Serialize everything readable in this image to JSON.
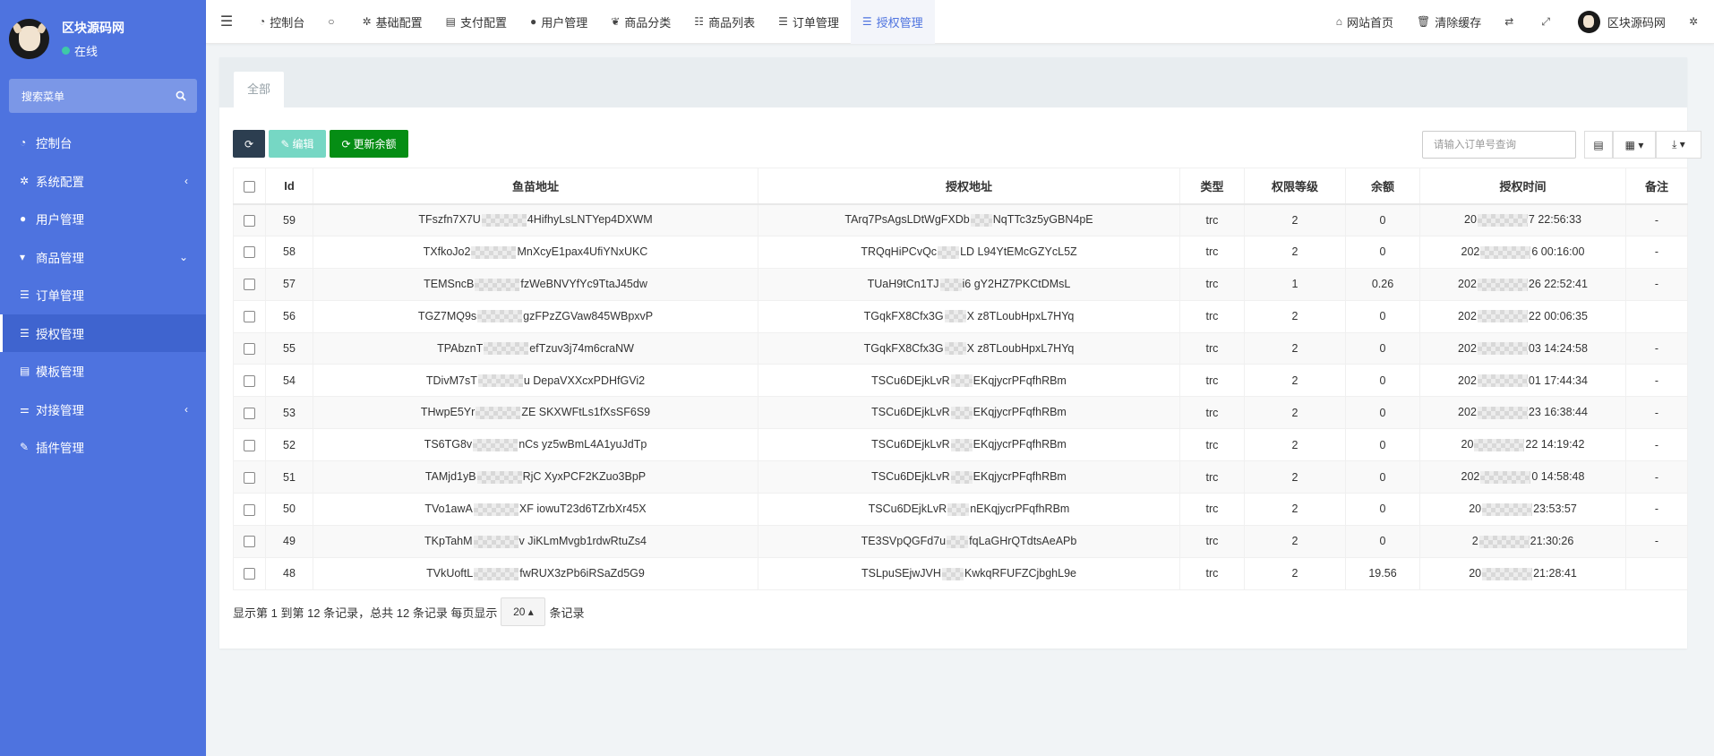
{
  "sidebar": {
    "user_name": "区块源码网",
    "status": "在线",
    "status_color": "#3ec9a7",
    "search_placeholder": "搜索菜单",
    "search_icon": "search-icon",
    "items": [
      {
        "label": "控制台",
        "icon": "dashboard-icon",
        "has_arrow": false
      },
      {
        "label": "系统配置",
        "icon": "gear-icon",
        "has_arrow": true
      },
      {
        "label": "用户管理",
        "icon": "user-icon",
        "has_arrow": false
      },
      {
        "label": "商品管理",
        "icon": "cart-icon",
        "has_arrow": true
      },
      {
        "label": "订单管理",
        "icon": "list-icon",
        "has_arrow": false
      },
      {
        "label": "授权管理",
        "icon": "list-icon",
        "has_arrow": false,
        "active": true
      },
      {
        "label": "模板管理",
        "icon": "template-icon",
        "has_arrow": false
      },
      {
        "label": "对接管理",
        "icon": "sliders-icon",
        "has_arrow": true
      },
      {
        "label": "插件管理",
        "icon": "plugin-icon",
        "has_arrow": false
      }
    ]
  },
  "navbar": {
    "tabs": [
      {
        "label": "控制台",
        "icon": "dashboard-icon"
      },
      {
        "label": "基础配置",
        "icon": "gear-icon"
      },
      {
        "label": "支付配置",
        "icon": "card-icon"
      },
      {
        "label": "用户管理",
        "icon": "user-icon"
      },
      {
        "label": "商品分类",
        "icon": "leaf-icon"
      },
      {
        "label": "商品列表",
        "icon": "list-icon"
      },
      {
        "label": "订单管理",
        "icon": "list-icon"
      },
      {
        "label": "授权管理",
        "icon": "list-icon",
        "active": true
      }
    ],
    "right": {
      "home_label": "网站首页",
      "clear_cache_label": "清除缓存",
      "user_name": "区块源码网"
    }
  },
  "content": {
    "tab_label": "全部",
    "toolbar": {
      "edit_label": "编辑",
      "update_balance_label": "更新余额",
      "search_placeholder": "请输入订单号查询"
    },
    "table": {
      "columns": [
        "Id",
        "鱼苗地址",
        "授权地址",
        "类型",
        "权限等级",
        "余额",
        "授权时间",
        "备注"
      ],
      "rows": [
        {
          "id": "59",
          "fish_a": "TFszfn7X7U",
          "fish_b": "4HifhyLsLNTYep4DXWM",
          "auth_a": "TArq7PsAgsLDtWgFXDb",
          "auth_b": "NqTTc3z5yGBN4pE",
          "type": "trc",
          "level": "2",
          "balance": "0",
          "time_a": "20",
          "time_b": "7 22:56:33",
          "note": "-"
        },
        {
          "id": "58",
          "fish_a": "TXfkoJo2",
          "fish_b": "MnXcyE1pax4UfiYNxUKC",
          "auth_a": "TRQqHiPCvQc",
          "auth_b": "LD   L94YtEMcGZYcL5Z",
          "type": "trc",
          "level": "2",
          "balance": "0",
          "time_a": "202",
          "time_b": "6 00:16:00",
          "note": "-"
        },
        {
          "id": "57",
          "fish_a": "TEMSncB",
          "fish_b": "fzWeBNVYfYc9TtaJ45dw",
          "auth_a": "TUaH9tCn1TJ",
          "auth_b": "i6   gY2HZ7PKCtDMsL",
          "type": "trc",
          "level": "1",
          "balance": "0.26",
          "time_a": "202",
          "time_b": "26 22:52:41",
          "note": "-"
        },
        {
          "id": "56",
          "fish_a": "TGZ7MQ9s",
          "fish_b": "gzFPzZGVaw845WBpxvP",
          "auth_a": "TGqkFX8Cfx3G",
          "auth_b": "X   z8TLoubHpxL7HYq",
          "type": "trc",
          "level": "2",
          "balance": "0",
          "time_a": "202",
          "time_b": "22 00:06:35",
          "note": ""
        },
        {
          "id": "55",
          "fish_a": "TPAbznT",
          "fish_b": "efTzuv3j74m6craNW",
          "auth_a": "TGqkFX8Cfx3G",
          "auth_b": "X   z8TLoubHpxL7HYq",
          "type": "trc",
          "level": "2",
          "balance": "0",
          "time_a": "202",
          "time_b": "03 14:24:58",
          "note": "-"
        },
        {
          "id": "54",
          "fish_a": "TDivM7sT",
          "fish_b": "u   DepaVXXcxPDHfGVi2",
          "auth_a": "TSCu6DEjkLvR",
          "auth_b": "EKqjycrPFqfhRBm",
          "type": "trc",
          "level": "2",
          "balance": "0",
          "time_a": "202",
          "time_b": "01 17:44:34",
          "note": "-"
        },
        {
          "id": "53",
          "fish_a": "THwpE5Yr",
          "fish_b": "ZE   SKXWFtLs1fXsSF6S9",
          "auth_a": "TSCu6DEjkLvR",
          "auth_b": "EKqjycrPFqfhRBm",
          "type": "trc",
          "level": "2",
          "balance": "0",
          "time_a": "202",
          "time_b": "23 16:38:44",
          "note": "-"
        },
        {
          "id": "52",
          "fish_a": "TS6TG8v",
          "fish_b": "nCs   yz5wBmL4A1yuJdTp",
          "auth_a": "TSCu6DEjkLvR",
          "auth_b": "EKqjycrPFqfhRBm",
          "type": "trc",
          "level": "2",
          "balance": "0",
          "time_a": "20",
          "time_b": "22 14:19:42",
          "note": "-"
        },
        {
          "id": "51",
          "fish_a": "TAMjd1yB",
          "fish_b": "RjC   XyxPCF2KZuo3BpP",
          "auth_a": "TSCu6DEjkLvR",
          "auth_b": "EKqjycrPFqfhRBm",
          "type": "trc",
          "level": "2",
          "balance": "0",
          "time_a": "202",
          "time_b": "0 14:58:48",
          "note": "-"
        },
        {
          "id": "50",
          "fish_a": "TVo1awA",
          "fish_b": "XF   iowuT23d6TZrbXr45X",
          "auth_a": "TSCu6DEjkLvR",
          "auth_b": "nEKqjycrPFqfhRBm",
          "type": "trc",
          "level": "2",
          "balance": "0",
          "time_a": "20",
          "time_b": "23:53:57",
          "note": "-"
        },
        {
          "id": "49",
          "fish_a": "TKpTahM",
          "fish_b": "v   JiKLmMvgb1rdwRtuZs4",
          "auth_a": "TE3SVpQGFd7u",
          "auth_b": "fqLaGHrQTdtsAeAPb",
          "type": "trc",
          "level": "2",
          "balance": "0",
          "time_a": "2",
          "time_b": "21:30:26",
          "note": "-"
        },
        {
          "id": "48",
          "fish_a": "TVkUoftL",
          "fish_b": "fwRUX3zPb6iRSaZd5G9",
          "auth_a": "TSLpuSEjwJVH",
          "auth_b": "KwkqRFUFZCjbghL9e",
          "type": "trc",
          "level": "2",
          "balance": "19.56",
          "time_a": "20",
          "time_b": "21:28:41",
          "note": ""
        }
      ]
    },
    "pagination": {
      "summary": "显示第 1 到第 12 条记录，总共 12 条记录 每页显示",
      "page_size": "20",
      "suffix": "条记录"
    }
  }
}
